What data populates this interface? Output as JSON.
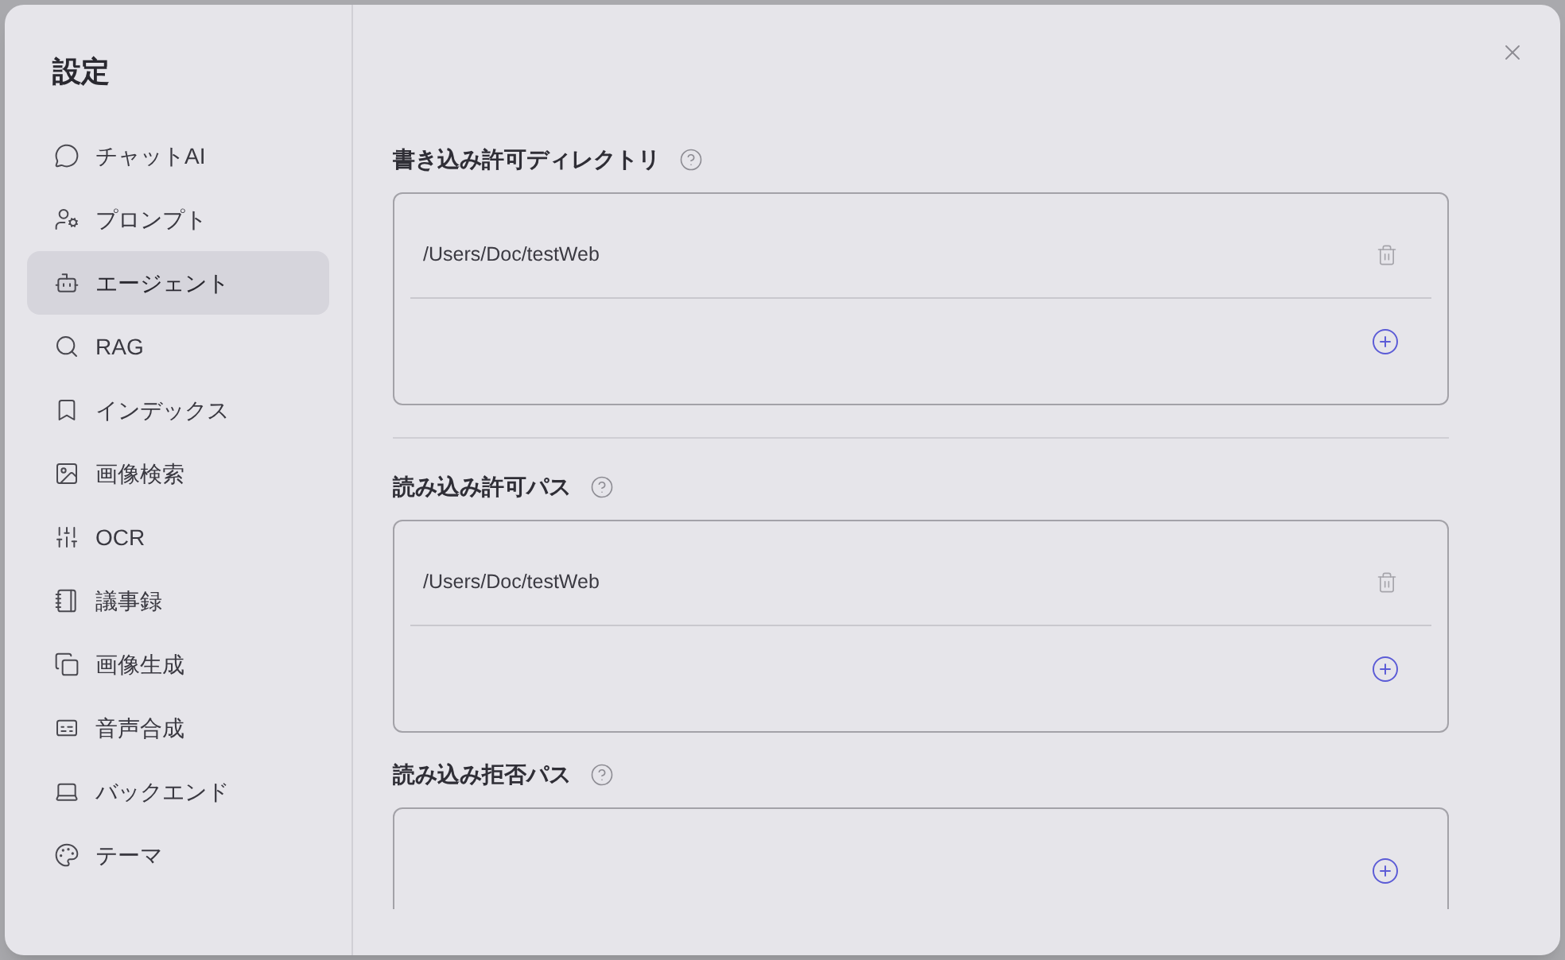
{
  "sidebar": {
    "title": "設定",
    "items": [
      {
        "label": "チャットAI",
        "selected": false
      },
      {
        "label": "プロンプト",
        "selected": false
      },
      {
        "label": "エージェント",
        "selected": true
      },
      {
        "label": "RAG",
        "selected": false
      },
      {
        "label": "インデックス",
        "selected": false
      },
      {
        "label": "画像検索",
        "selected": false
      },
      {
        "label": "OCR",
        "selected": false
      },
      {
        "label": "議事録",
        "selected": false
      },
      {
        "label": "画像生成",
        "selected": false
      },
      {
        "label": "音声合成",
        "selected": false
      },
      {
        "label": "バックエンド",
        "selected": false
      },
      {
        "label": "テーマ",
        "selected": false
      }
    ]
  },
  "groups": [
    {
      "sections": [
        {
          "heading": "書き込み許可ディレクトリ",
          "entries": [
            {
              "path": "/Users/Doc/testWeb"
            }
          ]
        }
      ]
    },
    {
      "sections": [
        {
          "heading": "読み込み許可パス",
          "entries": [
            {
              "path": "/Users/Doc/testWeb"
            }
          ]
        },
        {
          "heading": "読み込み拒否パス"
        }
      ]
    }
  ]
}
